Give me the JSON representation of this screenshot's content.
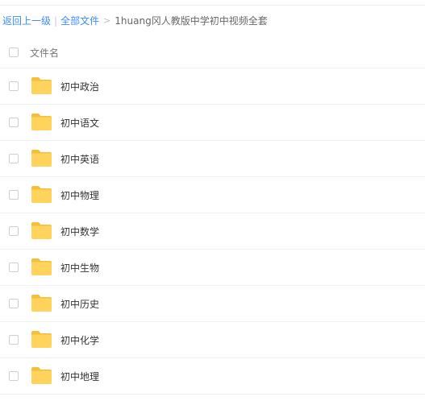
{
  "breadcrumb": {
    "back_label": "返回上一级",
    "separator": "|",
    "all_files_label": "全部文件",
    "arrow": ">",
    "current_folder": "1huang冈人教版中学初中视频全套"
  },
  "list_header": {
    "filename_label": "文件名"
  },
  "folders": [
    {
      "name": "初中政治",
      "icon": "folder-icon"
    },
    {
      "name": "初中语文",
      "icon": "folder-icon"
    },
    {
      "name": "初中英语",
      "icon": "folder-icon"
    },
    {
      "name": "初中物理",
      "icon": "folder-icon"
    },
    {
      "name": "初中数学",
      "icon": "folder-icon"
    },
    {
      "name": "初中生物",
      "icon": "folder-icon"
    },
    {
      "name": "初中历史",
      "icon": "folder-icon"
    },
    {
      "name": "初中化学",
      "icon": "folder-icon"
    },
    {
      "name": "初中地理",
      "icon": "folder-icon"
    }
  ],
  "colors": {
    "link": "#3b8cff",
    "folder": "#ffd35c",
    "folder_tab": "#f6bf3b"
  }
}
